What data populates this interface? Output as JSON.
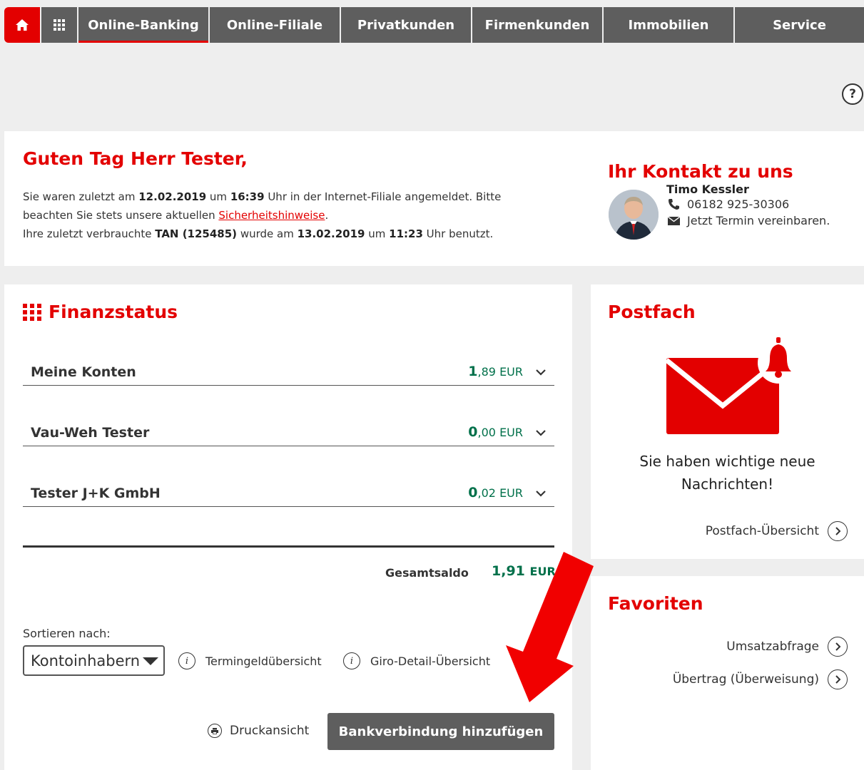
{
  "nav": {
    "items": [
      {
        "label": "Online-Banking",
        "active": true
      },
      {
        "label": "Online-Filiale"
      },
      {
        "label": "Privatkunden"
      },
      {
        "label": "Firmenkunden"
      },
      {
        "label": "Immobilien"
      },
      {
        "label": "Service"
      }
    ]
  },
  "help": {
    "label": "?"
  },
  "welcome": {
    "greeting": "Guten Tag Herr Tester,",
    "line1_a": "Sie waren zuletzt am ",
    "last_login_date": "12.02.2019",
    "line1_b": " um ",
    "last_login_time": "16:39",
    "line1_c": " Uhr in der Internet-Filiale angemeldet. Bitte",
    "line2_a": "beachten Sie stets unsere aktuellen ",
    "security_link": "Sicherheitshinweise",
    "line2_b": ".",
    "line3_a": "Ihre zuletzt verbrauchte ",
    "tan": "TAN (125485)",
    "line3_b": " wurde am ",
    "tan_date": "13.02.2019",
    "line3_c": " um ",
    "tan_time": "11:23",
    "line3_d": " Uhr benutzt."
  },
  "contact": {
    "title": "Ihr Kontakt zu uns",
    "name": "Timo Kessler",
    "phone": "06182 925-30306",
    "appointment": "Jetzt Termin vereinbaren."
  },
  "finanzstatus": {
    "title": "Finanzstatus",
    "accounts": [
      {
        "name": "Meine Konten",
        "amount_int": "1",
        "amount_dec": ",89 EUR"
      },
      {
        "name": "Vau-Weh Tester",
        "amount_int": "0",
        "amount_dec": ",00 EUR"
      },
      {
        "name": "Tester J+K GmbH",
        "amount_int": "0",
        "amount_dec": ",02 EUR"
      }
    ],
    "total_label": "Gesamtsaldo",
    "total_value": "1,91",
    "total_currency": "EUR",
    "sort_label": "Sortieren nach:",
    "sort_value": "Kontoinhabern",
    "link_termingeld": "Termingeldübersicht",
    "link_giro": "Giro-Detail-Übersicht",
    "print_label": "Druckansicht",
    "add_button": "Bankverbindung hinzufügen"
  },
  "postfach": {
    "title": "Postfach",
    "message_line1": "Sie haben wichtige neue",
    "message_line2": "Nachrichten!",
    "overview_link": "Postfach-Übersicht"
  },
  "favoriten": {
    "title": "Favoriten",
    "items": [
      "Umsatzabfrage",
      "Übertrag (Überweisung)"
    ]
  },
  "colors": {
    "brand_red": "#e30000",
    "nav_gray": "#5e5e5e",
    "amount_green": "#00704a"
  }
}
